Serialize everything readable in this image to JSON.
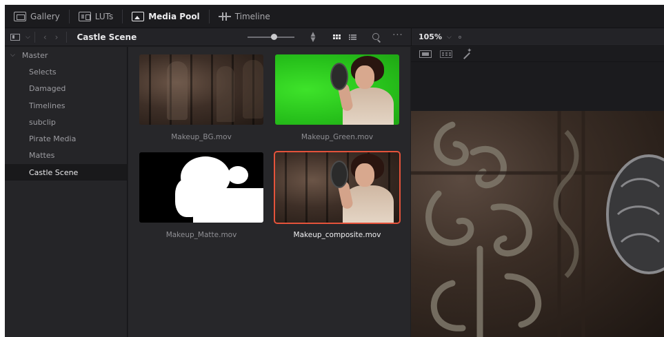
{
  "top_tabs": [
    {
      "label": "Gallery",
      "icon": "gallery-icon",
      "active": false
    },
    {
      "label": "LUTs",
      "icon": "luts-icon",
      "active": false
    },
    {
      "label": "Media Pool",
      "icon": "media-pool-icon",
      "active": true
    },
    {
      "label": "Timeline",
      "icon": "timeline-icon",
      "active": false
    }
  ],
  "toolbar": {
    "folder_title": "Castle Scene",
    "zoom": "105%"
  },
  "bins": {
    "master": "Master",
    "items": [
      "Selects",
      "Damaged",
      "Timelines",
      "subclip",
      "Pirate Media",
      "Mattes",
      "Castle Scene"
    ],
    "selected": "Castle Scene"
  },
  "clips": [
    {
      "name": "Makeup_BG.mov",
      "selected": false
    },
    {
      "name": "Makeup_Green.mov",
      "selected": false
    },
    {
      "name": "Makeup_Matte.mov",
      "selected": false
    },
    {
      "name": "Makeup_composite.mov",
      "selected": true
    }
  ],
  "colors": {
    "accent_selected_outline": "#e5533b",
    "background": "#1e1e21"
  }
}
